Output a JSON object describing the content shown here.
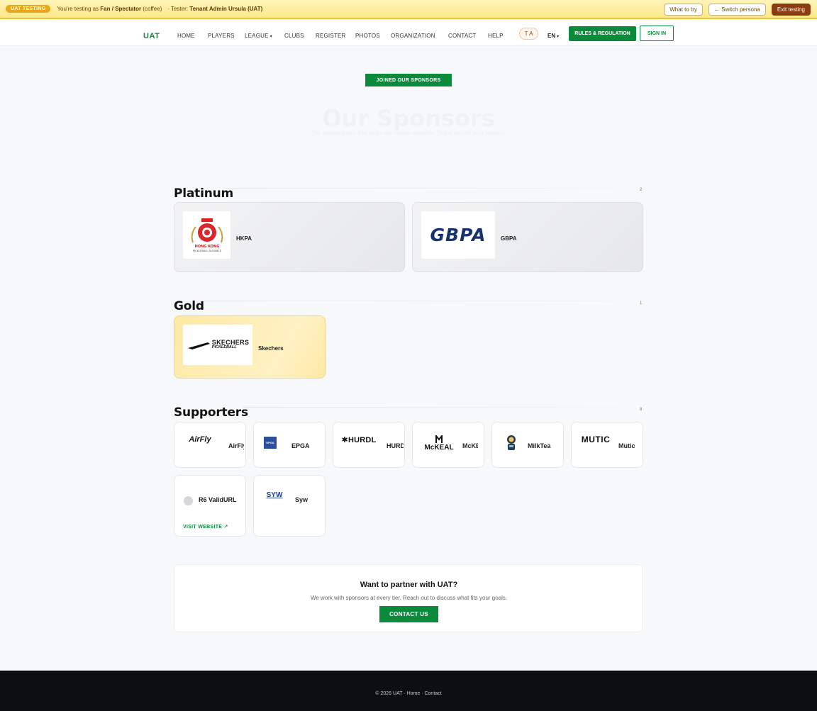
{
  "uat": {
    "pill": "UAT TESTING",
    "prefix": "You're testing as",
    "persona": "Fan / Spectator",
    "persona_note": "(coffee)",
    "tester_prefix": "· Tester:",
    "tester": "Tenant Admin Ursula (UAT)",
    "what_to_try": "What to try",
    "switch_persona": "← Switch persona",
    "exit": "Exit testing"
  },
  "nav": {
    "brand": "UAT",
    "items": [
      "HOME",
      "PLAYERS",
      "LEAGUE",
      "CLUBS",
      "REGISTER",
      "PHOTOS",
      "ORGANIZATION",
      "CONTACT",
      "HELP"
    ],
    "lang_toggle": "T A",
    "language": "EN",
    "rules_button": "RULES & REGULATION",
    "signin_button": "SIGN IN"
  },
  "hero": {
    "badge": "JOINED OUR SPONSORS",
    "title": "Our Sponsors",
    "subtitle": "The organizations that make our league possible. Thank you for your support."
  },
  "tiers": {
    "platinum": {
      "title": "Platinum",
      "count": "2",
      "sponsors": [
        {
          "name": "HKPA",
          "logo_text": "HONG KONG PICKLEBALL ALLIANCE"
        },
        {
          "name": "GBPA",
          "logo_text": "GBPA"
        }
      ]
    },
    "gold": {
      "title": "Gold",
      "count": "1",
      "sponsors": [
        {
          "name": "Skechers",
          "logo_text": "SKECHERS",
          "logo_sub": "PICKLEBALL"
        }
      ]
    },
    "supporters": {
      "title": "Supporters",
      "count": "8",
      "sponsors": [
        {
          "name": "AirFly",
          "logo_text": "AirFly"
        },
        {
          "name": "EPGA",
          "logo_text": "EPGA"
        },
        {
          "name": "HURDL",
          "logo_text": "HURDL"
        },
        {
          "name": "McKEAL",
          "logo_text": "McKEAL"
        },
        {
          "name": "MilkTea",
          "logo_text": "MilkTea"
        },
        {
          "name": "Mutic",
          "logo_text": "MUTIC"
        },
        {
          "name": "R6 ValidURL",
          "visit_link": "VISIT WEBSITE ↗"
        },
        {
          "name": "Syw",
          "logo_text": "SYW"
        }
      ]
    }
  },
  "partner": {
    "title": "Want to partner with UAT?",
    "subtitle": "We work with sponsors at every tier. Reach out to discuss what fits your goals.",
    "button": "CONTACT US"
  },
  "footer": {
    "text": "© 2026 UAT · Home · Contact"
  },
  "colors": {
    "brand_green": "#0c8a3b",
    "banner_yellow": "#fde98a",
    "exit_brown": "#8a3d10",
    "footer_dark": "#0c0e0f"
  }
}
